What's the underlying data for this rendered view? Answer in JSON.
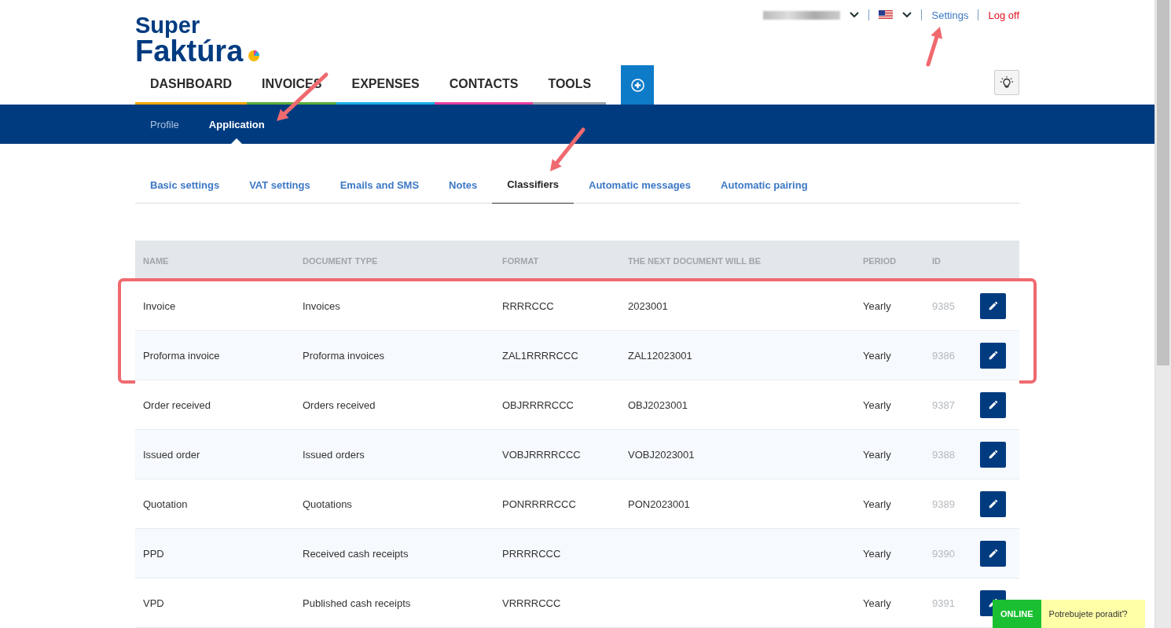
{
  "logo": {
    "line1": "Super",
    "line2": "Faktúra"
  },
  "top_links": [
    {
      "label": "Settings",
      "kind": "link"
    },
    {
      "label": "Log off",
      "kind": "danger"
    }
  ],
  "main_nav": [
    {
      "label": "DASHBOARD",
      "color": "#f5a800"
    },
    {
      "label": "INVOICES",
      "color": "#5aad3c"
    },
    {
      "label": "EXPENSES",
      "color": "#1bb0e8"
    },
    {
      "label": "CONTACTS",
      "color": "#e83ea0"
    },
    {
      "label": "TOOLS",
      "color": "#9aa3ab"
    }
  ],
  "sub_nav": [
    {
      "label": "Profile",
      "selected": false
    },
    {
      "label": "Application",
      "selected": true
    }
  ],
  "settings_tabs": [
    {
      "label": "Basic settings",
      "selected": false
    },
    {
      "label": "VAT settings",
      "selected": false
    },
    {
      "label": "Emails and SMS",
      "selected": false
    },
    {
      "label": "Notes",
      "selected": false
    },
    {
      "label": "Classifiers",
      "selected": true
    },
    {
      "label": "Automatic messages",
      "selected": false
    },
    {
      "label": "Automatic pairing",
      "selected": false
    }
  ],
  "table": {
    "columns": [
      "NAME",
      "DOCUMENT TYPE",
      "FORMAT",
      "THE NEXT DOCUMENT WILL BE",
      "PERIOD",
      "ID"
    ],
    "rows": [
      {
        "cells": [
          "Invoice",
          "Invoices",
          "RRRRCCC",
          "2023001",
          "Yearly",
          "9385"
        ],
        "highlighted": true
      },
      {
        "cells": [
          "Proforma invoice",
          "Proforma invoices",
          "ZAL1RRRRCCC",
          "ZAL12023001",
          "Yearly",
          "9386"
        ],
        "highlighted": true
      },
      {
        "cells": [
          "Order received",
          "Orders received",
          "OBJRRRRCCC",
          "OBJ2023001",
          "Yearly",
          "9387"
        ],
        "highlighted": false
      },
      {
        "cells": [
          "Issued order",
          "Issued orders",
          "VOBJRRRRCCC",
          "VOBJ2023001",
          "Yearly",
          "9388"
        ],
        "highlighted": false
      },
      {
        "cells": [
          "Quotation",
          "Quotations",
          "PONRRRRCCC",
          "PON2023001",
          "Yearly",
          "9389"
        ],
        "highlighted": false
      },
      {
        "cells": [
          "PPD",
          "Received cash receipts",
          "PRRRRCCC",
          "",
          "Yearly",
          "9390"
        ],
        "highlighted": false
      },
      {
        "cells": [
          "VPD",
          "Published cash receipts",
          "VRRRRCCC",
          "",
          "Yearly",
          "9391"
        ],
        "highlighted": false
      }
    ]
  },
  "chat": {
    "status": "ONLINE",
    "prompt": "Potrebujete poradiť?"
  }
}
